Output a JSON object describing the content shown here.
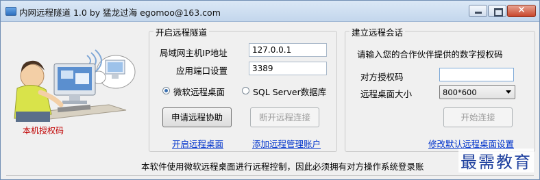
{
  "window": {
    "title": "内网远程隧道 1.0  by 猛龙过海  egomoo@163.com",
    "close_glyph": "✕"
  },
  "left": {
    "local_auth_label": "本机授权码"
  },
  "tunnel": {
    "title": "开启远程隧道",
    "lan_ip_label": "局域网主机IP地址",
    "lan_ip_value": "127.0.0.1",
    "port_label": "应用端口设置",
    "port_value": "3389",
    "radio_rdp_label": "微软远程桌面",
    "radio_sql_label": "SQL Server数据库",
    "request_button": "申请远程协助",
    "disconnect_button": "断开远程连接",
    "open_desktop_link": "开启远程桌面",
    "add_account_link": "添加远程管理账户"
  },
  "session": {
    "title": "建立远程会话",
    "prompt": "请输入您的合作伙伴提供的数字授权码",
    "peer_code_label": "对方授权码",
    "peer_code_value": "",
    "size_label": "远程桌面大小",
    "size_value": "800*600",
    "start_button": "开始连接",
    "modify_link": "修改默认远程桌面设置"
  },
  "footer": {
    "note": "本软件使用微软远程桌面进行远程控制，因此必须拥有对方操作系统登录账"
  },
  "watermark": {
    "text": "最需教育"
  }
}
